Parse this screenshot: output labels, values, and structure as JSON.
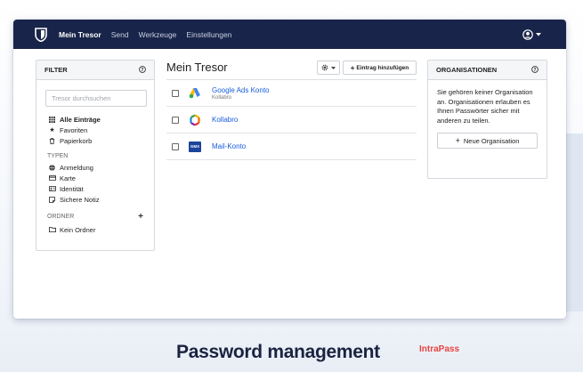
{
  "navbar": {
    "items": [
      {
        "label": "Mein Tresor",
        "active": true
      },
      {
        "label": "Send",
        "active": false
      },
      {
        "label": "Werkzeuge",
        "active": false
      },
      {
        "label": "Einstellungen",
        "active": false
      }
    ],
    "user_icon": "user-circle-icon"
  },
  "filter": {
    "title": "FILTER",
    "search_placeholder": "Tresor durchsuchen",
    "items": [
      {
        "label": "Alle Einträge",
        "icon": "grid-icon"
      },
      {
        "label": "Favoriten",
        "icon": "star-icon"
      },
      {
        "label": "Papierkorb",
        "icon": "trash-icon"
      }
    ],
    "types_title": "TYPEN",
    "types": [
      {
        "label": "Anmeldung",
        "icon": "globe-icon"
      },
      {
        "label": "Karte",
        "icon": "credit-card-icon"
      },
      {
        "label": "Identität",
        "icon": "id-card-icon"
      },
      {
        "label": "Sichere Notiz",
        "icon": "note-icon"
      }
    ],
    "folders_title": "ORDNER",
    "folders": [
      {
        "label": "Kein Ordner",
        "icon": "folder-icon"
      }
    ]
  },
  "main": {
    "title": "Mein Tresor",
    "add_label": "Eintrag hinzufügen",
    "items": [
      {
        "name": "Google Ads Konto",
        "sub": "Kollabro",
        "icon": "google-ads-icon"
      },
      {
        "name": "Kollabro",
        "sub": "",
        "icon": "kollabro-icon"
      },
      {
        "name": "Mail-Konto",
        "sub": "",
        "icon": "gmx-icon",
        "icon_text": "GMX"
      }
    ]
  },
  "organizations": {
    "title": "ORGANISATIONEN",
    "text": "Sie gehören keiner Organisation an. Organisationen erlauben es Ihnen Passwörter sicher mit anderen zu teilen.",
    "button_label": "Neue Organisation"
  },
  "caption": {
    "text": "Password management",
    "brand": "IntraPass"
  },
  "colors": {
    "navbar": "#182449",
    "link": "#175ddc",
    "brand": "#e8433f"
  }
}
